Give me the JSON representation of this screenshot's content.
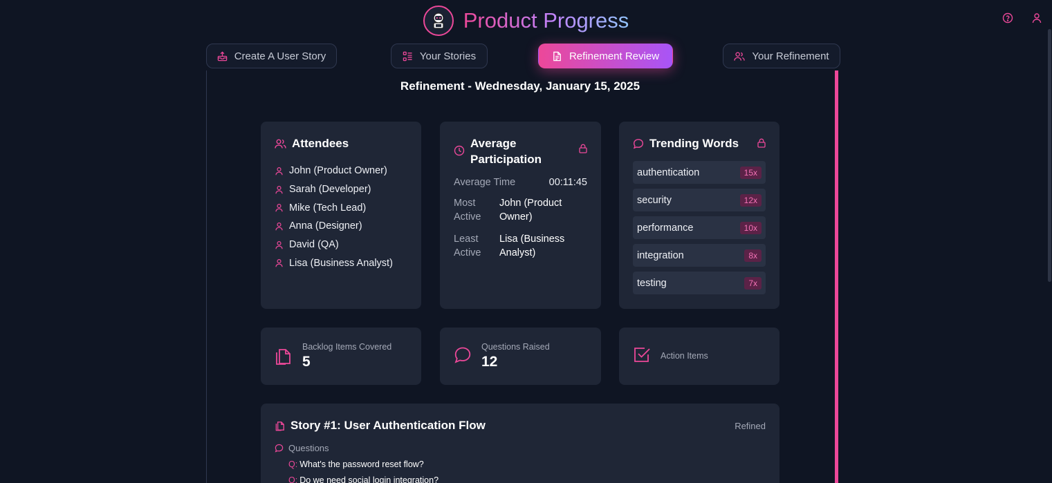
{
  "app": {
    "title": "Product Progress"
  },
  "nav": {
    "tabs": [
      {
        "label": "Create A User Story",
        "icon": "inbox-upload-icon"
      },
      {
        "label": "Your Stories",
        "icon": "list-icon"
      },
      {
        "label": "Refinement Review",
        "icon": "document-icon",
        "active": true
      },
      {
        "label": "Your Refinement",
        "icon": "users-icon"
      }
    ]
  },
  "review": {
    "title": "Refinement - Wednesday, January 15, 2025"
  },
  "attendees": {
    "title": "Attendees",
    "items": [
      "John (Product Owner)",
      "Sarah (Developer)",
      "Mike (Tech Lead)",
      "Anna (Designer)",
      "David (QA)",
      "Lisa (Business Analyst)"
    ]
  },
  "participation": {
    "title": "Average Participation",
    "avg_time_label": "Average Time",
    "avg_time_value": "00:11:45",
    "most_active_label": "Most Active",
    "most_active_value": "John (Product Owner)",
    "least_active_label": "Least Active",
    "least_active_value": "Lisa (Business Analyst)"
  },
  "trending": {
    "title": "Trending Words",
    "items": [
      {
        "word": "authentication",
        "count": "15x"
      },
      {
        "word": "security",
        "count": "12x"
      },
      {
        "word": "performance",
        "count": "10x"
      },
      {
        "word": "integration",
        "count": "8x"
      },
      {
        "word": "testing",
        "count": "7x"
      }
    ]
  },
  "stats": {
    "backlog_label": "Backlog Items Covered",
    "backlog_value": "5",
    "questions_label": "Questions Raised",
    "questions_value": "12",
    "actions_label": "Action Items"
  },
  "story": {
    "title": "Story #1: User Authentication Flow",
    "status": "Refined",
    "questions_label": "Questions",
    "question_prefix": "Q:",
    "questions": [
      "What's the password reset flow?",
      "Do we need social login integration?"
    ]
  },
  "colors": {
    "accent": "#ec4899",
    "accent2": "#a855f7",
    "background": "#0f1523",
    "card": "#1f2636"
  }
}
